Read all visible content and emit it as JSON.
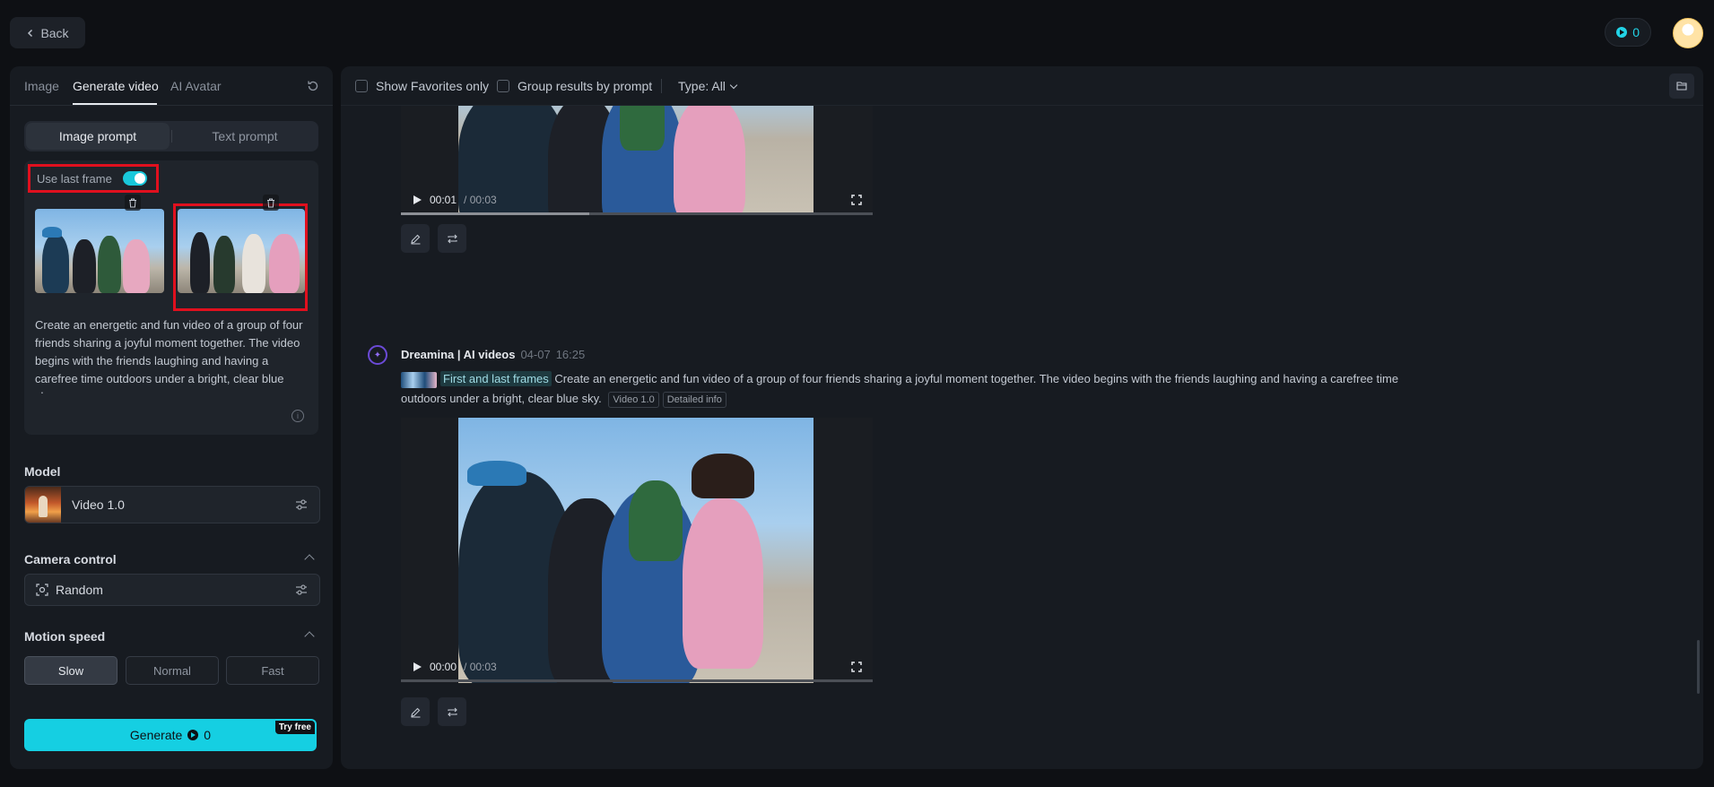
{
  "topbar": {
    "back_label": "Back",
    "credits": "0"
  },
  "left": {
    "tabs": [
      "Image",
      "Generate video",
      "AI Avatar"
    ],
    "prompt_modes": [
      "Image prompt",
      "Text prompt"
    ],
    "use_last_frame_label": "Use last frame",
    "prompt_text": "Create an energetic and fun video of a group of four friends sharing a joyful moment together. The video begins with the friends laughing and having a carefree time outdoors under a bright, clear blue sky.",
    "model_label": "Model",
    "model_name": "Video 1.0",
    "camera_label": "Camera control",
    "camera_value": "Random",
    "motion_label": "Motion speed",
    "speeds": [
      "Slow",
      "Normal",
      "Fast"
    ],
    "generate_label": "Generate",
    "generate_credits": "0",
    "try_free": "Try free"
  },
  "main": {
    "filters": {
      "favorites": "Show Favorites only",
      "group": "Group results by prompt",
      "type": "Type: All"
    },
    "video1": {
      "current": "00:01",
      "total": "/ 00:03",
      "progress": 0.4
    },
    "message": {
      "author": "Dreamina | AI videos",
      "date": "04-07",
      "time": "16:25",
      "tag_frames": "First and last frames",
      "text": "Create an energetic and fun video of a group of four friends sharing a joyful moment together. The video begins with the friends laughing and having a carefree time outdoors under a bright, clear blue sky.",
      "tag_model": "Video 1.0",
      "tag_info": "Detailed info"
    },
    "video2": {
      "current": "00:00",
      "total": "/ 00:03",
      "progress": 0.0
    }
  }
}
